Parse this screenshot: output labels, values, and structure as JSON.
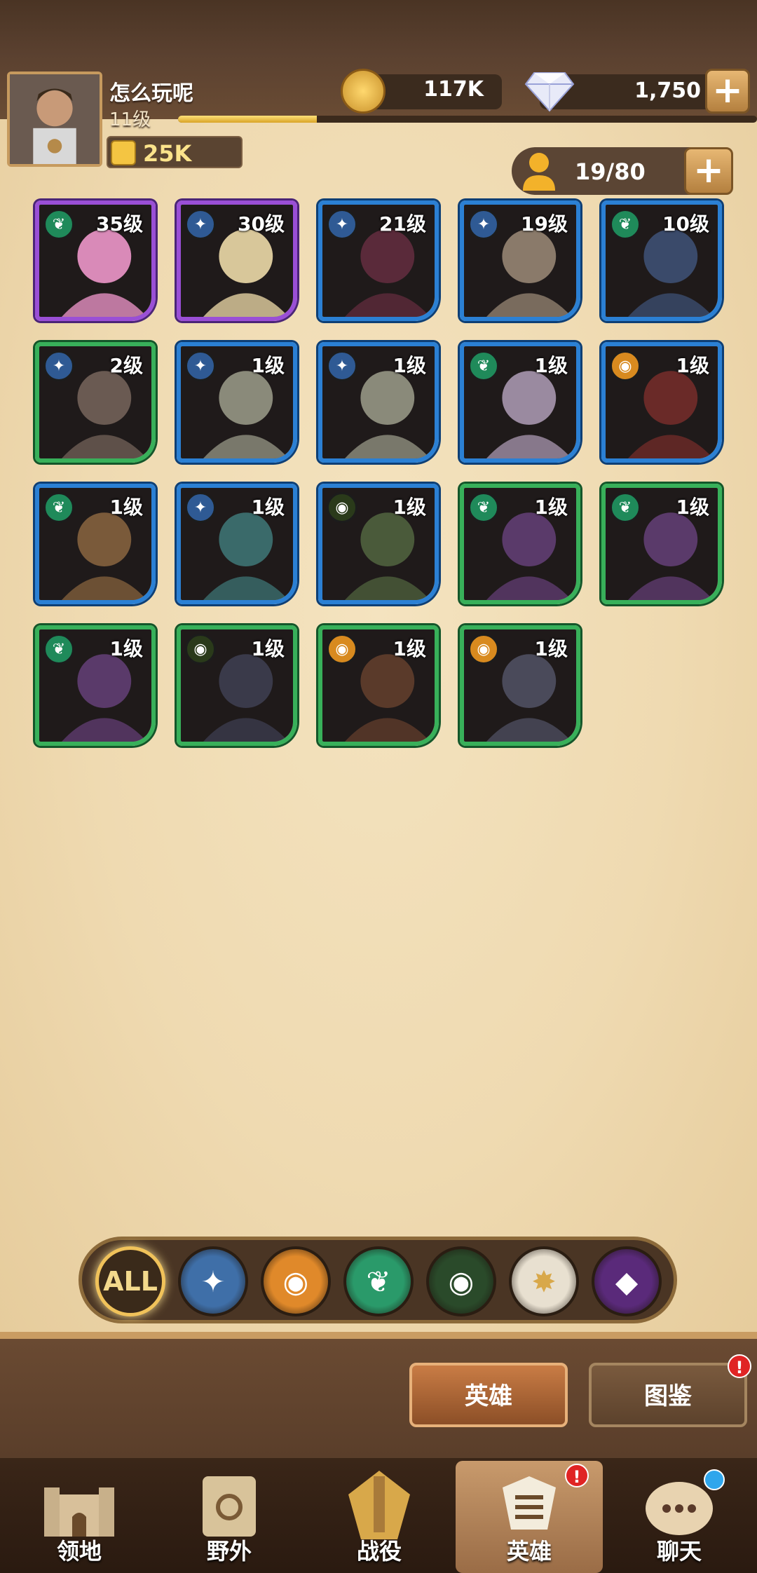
{
  "player": {
    "name": "怎么玩呢",
    "level": "11级",
    "xp_fraction": 0.24,
    "power": "25K"
  },
  "currency": {
    "gold": "117K",
    "gems": "1,750"
  },
  "hero_count": "19/80",
  "heroes": [
    {
      "level": "35级",
      "rarity": "purple",
      "faction": "forest",
      "art": "#d98ab8"
    },
    {
      "level": "30级",
      "rarity": "purple",
      "faction": "lightbearer",
      "art": "#d8c79a"
    },
    {
      "level": "21级",
      "rarity": "blue",
      "faction": "lightbearer",
      "art": "#5a2a3a"
    },
    {
      "level": "19级",
      "rarity": "blue",
      "faction": "lightbearer",
      "art": "#8a7a6a"
    },
    {
      "level": "10级",
      "rarity": "blue",
      "faction": "forest",
      "art": "#3a4a6a"
    },
    {
      "level": "2级",
      "rarity": "green",
      "faction": "lightbearer",
      "art": "#6a5a52"
    },
    {
      "level": "1级",
      "rarity": "blue",
      "faction": "lightbearer",
      "art": "#8a8a7a"
    },
    {
      "level": "1级",
      "rarity": "blue",
      "faction": "lightbearer",
      "art": "#8a8a7a"
    },
    {
      "level": "1级",
      "rarity": "blue",
      "faction": "forest",
      "art": "#9a8aa0"
    },
    {
      "level": "1级",
      "rarity": "blue",
      "faction": "mauler",
      "art": "#6a2a28"
    },
    {
      "level": "1级",
      "rarity": "blue",
      "faction": "forest",
      "art": "#7a5a3a"
    },
    {
      "level": "1级",
      "rarity": "blue",
      "faction": "lightbearer",
      "art": "#3a6a6a"
    },
    {
      "level": "1级",
      "rarity": "blue",
      "faction": "graveborn",
      "art": "#4a5a3a"
    },
    {
      "level": "1级",
      "rarity": "green",
      "faction": "forest",
      "art": "#5a3a6a"
    },
    {
      "level": "1级",
      "rarity": "green",
      "faction": "forest",
      "art": "#5a3a6a"
    },
    {
      "level": "1级",
      "rarity": "green",
      "faction": "forest",
      "art": "#5a3a6a"
    },
    {
      "level": "1级",
      "rarity": "green",
      "faction": "graveborn",
      "art": "#3a3a4a"
    },
    {
      "level": "1级",
      "rarity": "green",
      "faction": "mauler",
      "art": "#5a3a2a"
    },
    {
      "level": "1级",
      "rarity": "green",
      "faction": "mauler",
      "art": "#4a4a5a"
    }
  ],
  "filters": [
    {
      "name": "all",
      "label": "ALL",
      "color": "#3a2a1a"
    },
    {
      "name": "lightbearer",
      "label": "✦",
      "color": "#3f6fa8"
    },
    {
      "name": "mauler",
      "label": "◉",
      "color": "#e0892a"
    },
    {
      "name": "wilder",
      "label": "❦",
      "color": "#2a9a6a"
    },
    {
      "name": "graveborn",
      "label": "◉",
      "color": "#2a4a2a"
    },
    {
      "name": "celestial",
      "label": "✸",
      "color": "#e8e0d0"
    },
    {
      "name": "hypogean",
      "label": "◆",
      "color": "#5a2a7a"
    }
  ],
  "subtabs": {
    "heroes": "英雄",
    "codex": "图鉴",
    "alert": "!"
  },
  "nav": [
    {
      "name": "territory",
      "label": "领地"
    },
    {
      "name": "wilderness",
      "label": "野外"
    },
    {
      "name": "campaign",
      "label": "战役"
    },
    {
      "name": "heroes",
      "label": "英雄"
    },
    {
      "name": "chat",
      "label": "聊天"
    }
  ],
  "nav_alert": "!",
  "colors": {
    "purple": "#9a4fd6",
    "blue": "#2b80d4",
    "green": "#38b05a",
    "lightbearer": "#2f5a94",
    "forest": "#1f8a5a",
    "mauler": "#d88a1f",
    "graveborn": "#2a3a1a"
  }
}
